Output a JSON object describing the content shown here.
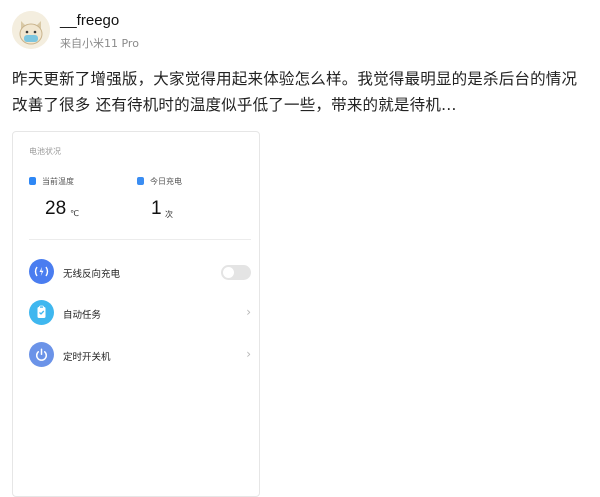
{
  "post": {
    "username": "__freego",
    "source": "来自小米11 Pro",
    "text": "昨天更新了增强版，大家觉得用起来体验怎么样。我觉得最明显的是杀后台的情况改善了很多 还有待机时的温度似乎低了一些，带来的就是待机…"
  },
  "card": {
    "title": "电池状况",
    "stats": [
      {
        "label": "当前温度",
        "value": "28",
        "unit": "℃"
      },
      {
        "label": "今日充电",
        "value": "1",
        "unit": "次"
      }
    ],
    "rows": [
      {
        "label": "无线反向充电",
        "icon": "wireless-charge-icon",
        "color": "#4a7df0",
        "control": "toggle",
        "on": false
      },
      {
        "label": "自动任务",
        "icon": "clipboard-check-icon",
        "color": "#3fb7ef",
        "control": "chevron"
      },
      {
        "label": "定时开关机",
        "icon": "power-icon",
        "color": "#6b93e8",
        "control": "chevron"
      }
    ]
  },
  "colors": {
    "accent": "#2e87f5",
    "text": "#222222",
    "muted": "#8a8a8a"
  }
}
